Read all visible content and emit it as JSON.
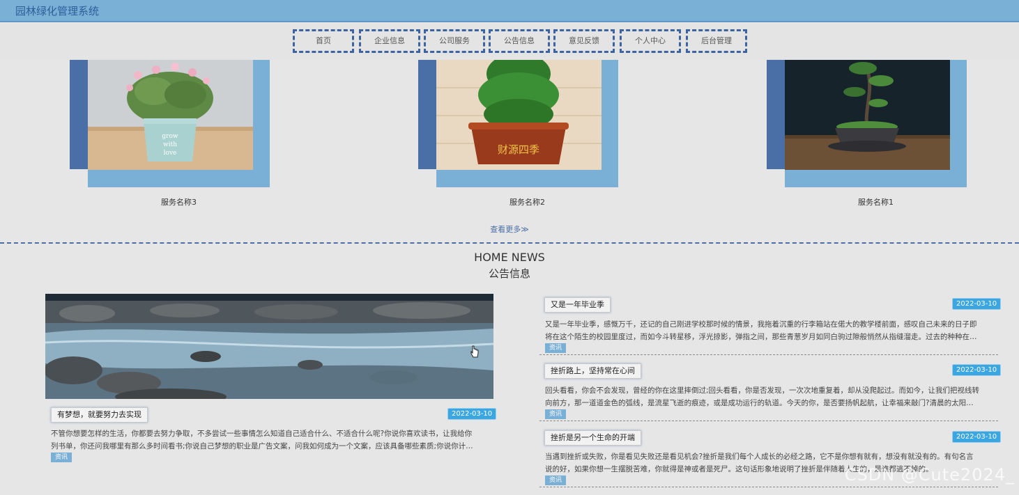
{
  "header": {
    "app_title": "园林绿化管理系统"
  },
  "nav": {
    "items": [
      {
        "label": "首页"
      },
      {
        "label": "企业信息"
      },
      {
        "label": "公司服务"
      },
      {
        "label": "公告信息"
      },
      {
        "label": "意见反馈"
      },
      {
        "label": "个人中心"
      },
      {
        "label": "后台管理"
      }
    ]
  },
  "services": {
    "items": [
      {
        "name": "服务名称3",
        "image": "flower-pot-photo"
      },
      {
        "name": "服务名称2",
        "image": "pine-bonsai-photo"
      },
      {
        "name": "服务名称1",
        "image": "bonsai-tree-photo"
      }
    ],
    "more_label": "查看更多≫"
  },
  "news": {
    "heading_en": "HOME NEWS",
    "heading_cn": "公告信息",
    "featured": {
      "title": "有梦想，就要努力去实现",
      "date": "2022-03-10",
      "excerpt_line1": "不管你想要怎样的生活，你都要去努力争取，不多尝试一些事情怎么知道自己适合什么、不适合什么呢?你说你喜欢读书，让我给你",
      "excerpt_line2": "列书单，你还问我哪里有那么多时间看书;你说自己梦想的职业是广告文案，问我如何成为一个文案，应该具备哪些素质;你说你计…",
      "tag": "资讯",
      "image": "river-rocks-photo"
    },
    "list": [
      {
        "title": "又是一年毕业季",
        "date": "2022-03-10",
        "excerpt_line1": "又是一年毕业季，感慨万千，还记的自己刚进学校那时候的情景，我拖着沉重的行李箱站在偌大的教学楼前面，感叹自己未来的日子即",
        "excerpt_line2": "将在这个陌生的校园里度过，而如今斗转星移，浮光掠影，弹指之间，那些青葱岁月如同白驹过隙般悄然从指缝溜走。过去的种种在…",
        "tag": "资讯"
      },
      {
        "title": "挫折路上，坚持常在心间",
        "date": "2022-03-10",
        "excerpt_line1": "回头看看，你会不会发现，曾经的你在这里摔倒过;回头看看，你是否发现，一次次地重复着，却从没爬起过。而如今，让我们把视线转",
        "excerpt_line2": "向前方，那一道道金色的弧线，是流星飞逝的痕迹，或是成功运行的轨道。今天的你，是否要扬帆起航，让幸福来敲门?清晨的太阳…",
        "tag": "资讯"
      },
      {
        "title": "挫折是另一个生命的开端",
        "date": "2022-03-10",
        "excerpt_line1": "当遇到挫折或失败，你是看见失败还是看见机会?挫折是我们每个人成长的必经之路，它不是你想有就有，想没有就没有的。有句名言",
        "excerpt_line2": "说的好，如果你想一生摆脱苦难，你就得是神或者是死尸。这句话形象地说明了挫折是伴随着人生的，是谁都逃不掉的。",
        "tag": "资讯"
      }
    ]
  },
  "watermark": "CSDN @Cute2024_",
  "colors": {
    "header": "#7aafd6",
    "accent": "#4a6ea6",
    "date_badge": "#3ba6df"
  }
}
